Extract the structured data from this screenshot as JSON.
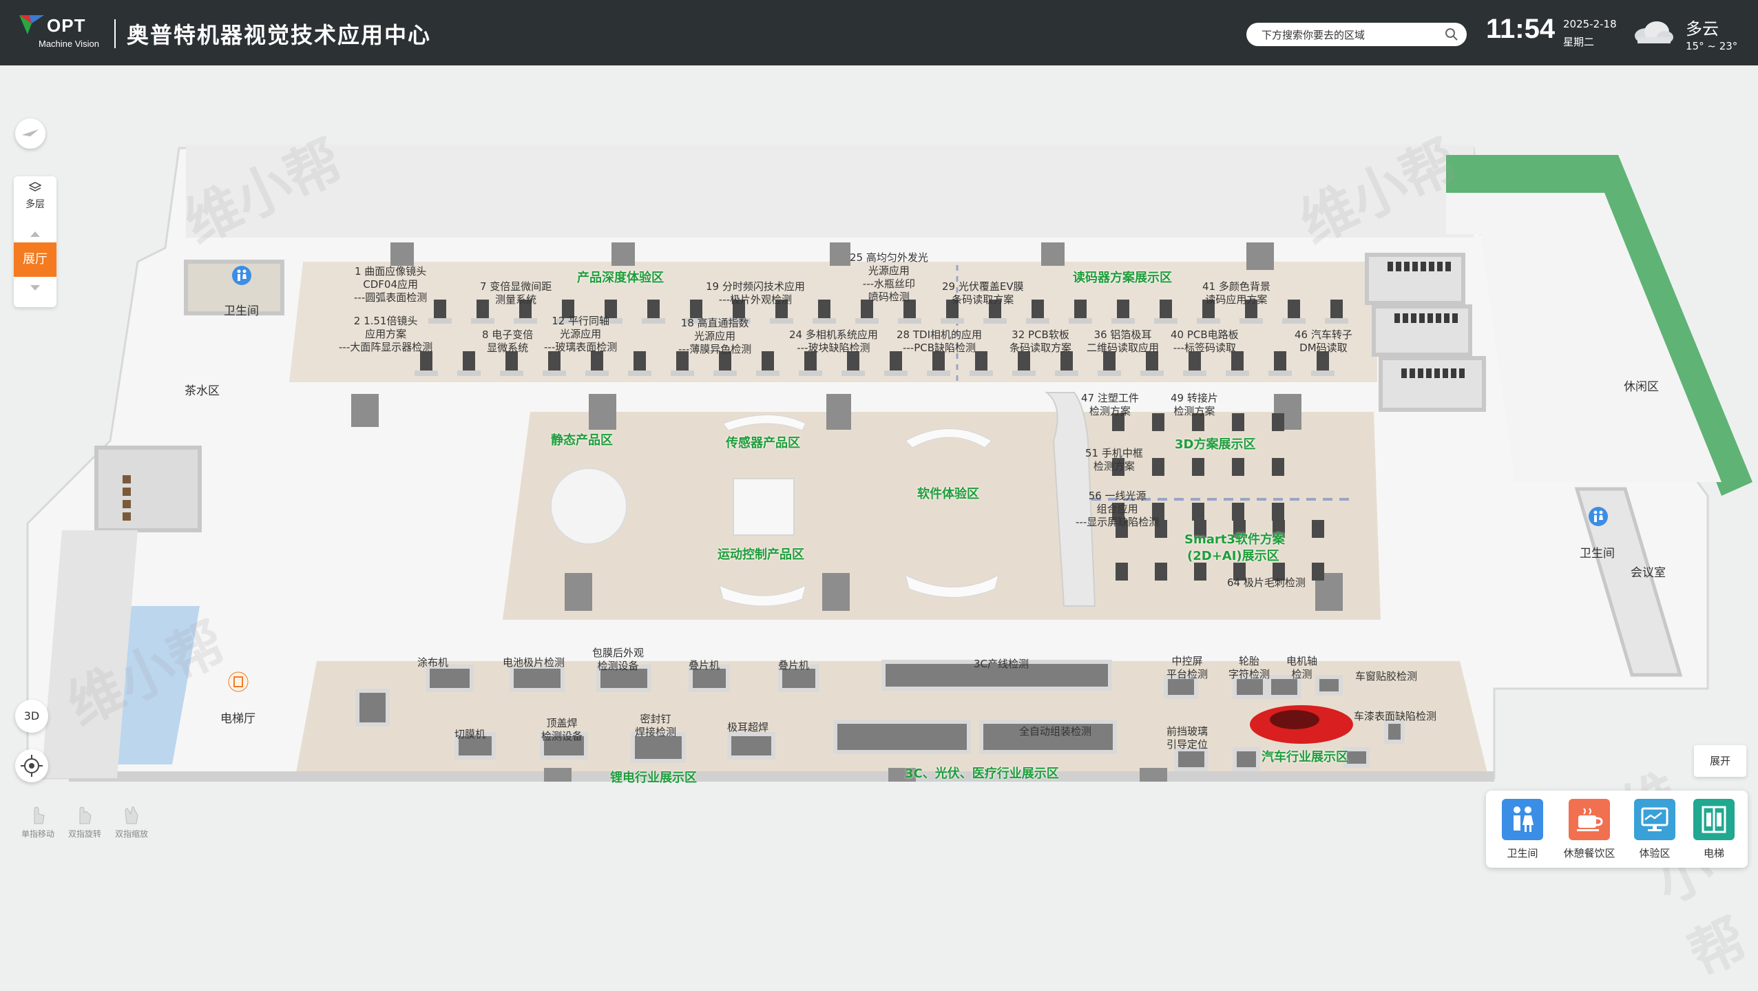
{
  "header": {
    "logo_text": "OPT",
    "logo_sub": "Machine Vision",
    "title": "奥普特机器视觉技术应用中心",
    "search_placeholder": "下方搜索你要去的区域",
    "time": "11:54",
    "date": "2025-2-18",
    "weekday": "星期二",
    "weather": "多云",
    "temperature": "15° ~ 23°",
    "weather_icon": "cloud-icon"
  },
  "colors": {
    "header_bg": "#2c3133",
    "accent_orange": "#f47b20",
    "zone_green": "#1f9d3b",
    "quick_restroom": "#3a8ee6",
    "quick_rest": "#f07050",
    "quick_experience": "#3aa0d8",
    "quick_elevator": "#20a890"
  },
  "left_controls": {
    "multi_floor": "多层",
    "current_floor": "展厅",
    "view_3d": "3D",
    "gestures": [
      "单指移动",
      "双指旋转",
      "双指缩放"
    ]
  },
  "expand_button": "展开",
  "quick_access": [
    {
      "label": "卫生间",
      "icon": "restroom-icon"
    },
    {
      "label": "休憩餐饮区",
      "icon": "coffee-cup-icon"
    },
    {
      "label": "体验区",
      "icon": "monitor-icon"
    },
    {
      "label": "电梯",
      "icon": "elevator-icon"
    }
  ],
  "watermark": "维小帮",
  "areas": {
    "restroom_left": "卫生间",
    "tea_area": "茶水区",
    "elevator_hall": "电梯厅",
    "rest_area": "休闲区",
    "restroom_right": "卫生间",
    "meeting_room": "会议室"
  },
  "zones": {
    "product_depth": "产品深度体验区",
    "reader_solution": "读码器方案展示区",
    "static_product": "静态产品区",
    "sensor_product": "传感器产品区",
    "software_experience": "软件体验区",
    "motion_control": "运动控制产品区",
    "solution_3d": "3D方案展示区",
    "smart3_line1": "Smart3软件方案",
    "smart3_line2": "(2D+AI)展示区",
    "lithium": "锂电行业展示区",
    "industry_3c": "3C、光伏、医疗行业展示区",
    "auto": "汽车行业展示区"
  },
  "station_labels": {
    "s1": [
      "1 曲面应像镜头",
      "CDF04应用",
      "---圆弧表面检测"
    ],
    "s2": [
      "2 1.51倍镜头",
      "应用方案",
      "---大面阵显示器检测"
    ],
    "s7": [
      "7 变倍显微间距",
      "测量系统"
    ],
    "s8": [
      "8 电子变倍",
      "显微系统"
    ],
    "s12": [
      "12 平行同轴",
      "光源应用",
      "---玻璃表面检测"
    ],
    "s18": [
      "18 高直通指数",
      "光源应用",
      "---薄膜异色检测"
    ],
    "s19": [
      "19 分时频闪技术应用",
      "---极片外观检测"
    ],
    "s24": [
      "24 多相机系统应用",
      "---玻块缺陷检测"
    ],
    "s25": [
      "25 高均匀外发光",
      "光源应用",
      "---水瓶丝印",
      "喷码检测"
    ],
    "s28": [
      "28 TDI相机的应用",
      "---PCB缺陷检测"
    ],
    "s29": [
      "29 光伏覆盖EV膜",
      "条码读取方案"
    ],
    "s32": [
      "32 PCB软板",
      "条码读取方案"
    ],
    "s36": [
      "36 铝箔极耳",
      "二维码读取应用"
    ],
    "s40": [
      "40 PCB电路板",
      "---标签码读取"
    ],
    "s41": [
      "41 多颜色背景",
      "读码应用方案"
    ],
    "s46": [
      "46 汽车转子",
      "DM码读取"
    ],
    "s47": [
      "47 注塑工件",
      "检测方案"
    ],
    "s49": [
      "49 转接片",
      "检测方案"
    ],
    "s51": [
      "51 手机中框",
      "检测方案"
    ],
    "s56": [
      "56 一线光源",
      "组合应用",
      "---显示屏缺陷检测"
    ],
    "s64": [
      "64 极片毛刺检测"
    ]
  },
  "bottom_labels": {
    "lithium_1": "涂布机",
    "lithium_2": "电池极片检测",
    "lithium_3": [
      "包膜后外观",
      "检测设备"
    ],
    "lithium_4": "叠片机",
    "lithium_5": "叠片机",
    "lithium_6": "切膜机",
    "lithium_7": [
      "顶盖焊",
      "检测设备"
    ],
    "lithium_8": [
      "密封钉",
      "焊接检测"
    ],
    "lithium_9": "极耳超焊",
    "line_3c": "3C产线检测",
    "line_3c_2": "全自动组装检测",
    "auto_1": [
      "中控屏",
      "平台检测"
    ],
    "auto_2": [
      "轮胎",
      "字符检测"
    ],
    "auto_3": [
      "电机轴",
      "检测"
    ],
    "auto_4": "车窗贴胶检测",
    "auto_5": "车漆表面缺陷检测",
    "auto_6": [
      "前挡玻璃",
      "引导定位"
    ]
  }
}
